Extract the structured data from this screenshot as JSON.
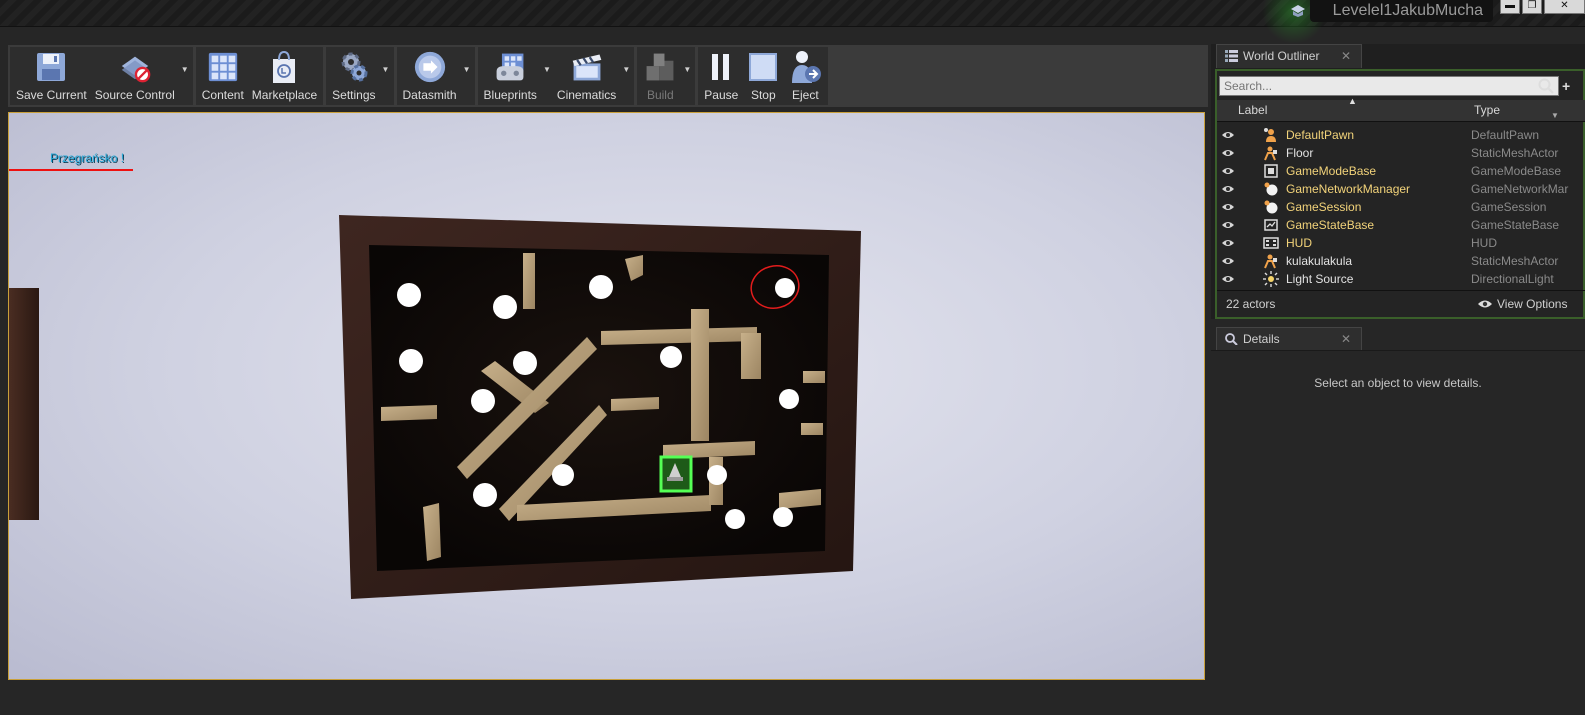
{
  "window": {
    "level_name": "Levelel1JakubMucha"
  },
  "toolbar": {
    "buttons": [
      {
        "label": "Save Current"
      },
      {
        "label": "Source Control"
      },
      {
        "label": "Content"
      },
      {
        "label": "Marketplace"
      },
      {
        "label": "Settings"
      },
      {
        "label": "Datasmith"
      },
      {
        "label": "Blueprints"
      },
      {
        "label": "Cinematics"
      },
      {
        "label": "Build"
      },
      {
        "label": "Pause"
      },
      {
        "label": "Stop"
      },
      {
        "label": "Eject"
      }
    ]
  },
  "viewport": {
    "hud_message": "Przegrańsko !"
  },
  "outliner": {
    "tab_title": "World Outliner",
    "search_placeholder": "Search...",
    "col_label": "Label",
    "col_type": "Type",
    "rows": [
      {
        "label": "DefaultPawn",
        "type": "DefaultPawn",
        "icon": "pawn-icon",
        "color": "#f2d37a"
      },
      {
        "label": "Floor",
        "type": "StaticMeshActor",
        "icon": "static-mesh-icon",
        "color": "#e2e2e2"
      },
      {
        "label": "GameModeBase",
        "type": "GameModeBase",
        "icon": "gamemode-icon",
        "color": "#f2d37a"
      },
      {
        "label": "GameNetworkManager",
        "type": "GameNetworkMar",
        "icon": "actor-sphere-icon",
        "color": "#f2d37a"
      },
      {
        "label": "GameSession",
        "type": "GameSession",
        "icon": "actor-sphere-icon",
        "color": "#f2d37a"
      },
      {
        "label": "GameStateBase",
        "type": "GameStateBase",
        "icon": "gamestate-icon",
        "color": "#f2d37a"
      },
      {
        "label": "HUD",
        "type": "HUD",
        "icon": "hud-icon",
        "color": "#f2d37a"
      },
      {
        "label": "kulakulakula",
        "type": "StaticMeshActor",
        "icon": "static-mesh-icon",
        "color": "#e2e2e2"
      },
      {
        "label": "Light Source",
        "type": "DirectionalLight",
        "icon": "light-icon",
        "color": "#e2e2e2"
      }
    ],
    "actor_count": "22 actors",
    "view_options": "View Options"
  },
  "details": {
    "tab_title": "Details",
    "empty_message": "Select an object to view details."
  },
  "colors": {
    "accent_green": "#3a5f2a",
    "viewport_border": "#c9a03a",
    "annotation": "#e11"
  }
}
